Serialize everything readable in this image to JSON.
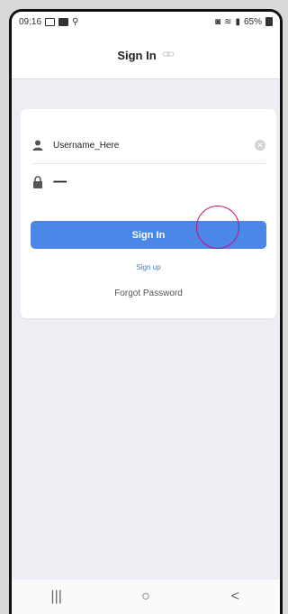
{
  "status": {
    "time": "09:16",
    "battery": "65%"
  },
  "header": {
    "title": "Sign In",
    "title_icon": "link-icon"
  },
  "form": {
    "username_value": "Username_Here",
    "password_value": "••••••••••",
    "signin_label": "Sign In",
    "signup_label": "Sign up",
    "forgot_label": "Forgot Password"
  },
  "navbar": {
    "recents": "|||",
    "home": "○",
    "back": "<"
  },
  "colors": {
    "accent": "#4b87e6",
    "background": "#eceef3",
    "touch_indicator": "#c2107e"
  }
}
